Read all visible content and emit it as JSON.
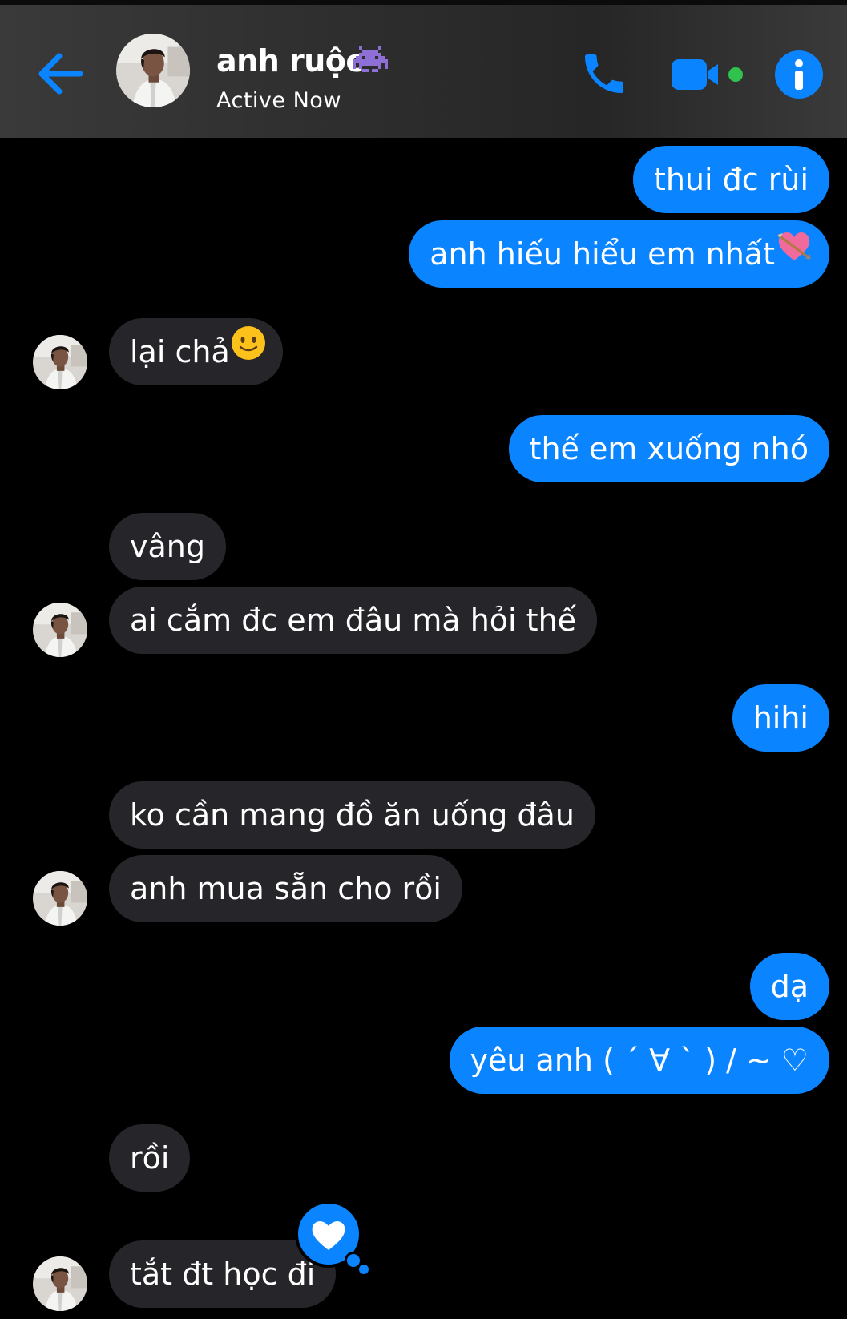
{
  "header": {
    "contact_name": "anh ruộc",
    "status": "Active Now",
    "name_emoji_icon": "alien-monster-icon",
    "accent_color": "#0a84ff"
  },
  "messages": [
    {
      "side": "out",
      "text": "thui đc rùi"
    },
    {
      "side": "out",
      "text": "anh hiếu hiểu em nhất",
      "emoji_icon": "heart-with-arrow-icon"
    },
    {
      "side": "in",
      "text": "lại chả",
      "emoji_icon": "slightly-smiling-face-icon"
    },
    {
      "side": "out",
      "text": "thế em xuống nhó"
    },
    {
      "side": "in",
      "text": "vâng"
    },
    {
      "side": "in",
      "text": "ai cắm đc em đâu mà hỏi thế"
    },
    {
      "side": "out",
      "text": "hihi"
    },
    {
      "side": "in",
      "text": "ko cần mang đồ ăn uống đâu"
    },
    {
      "side": "in",
      "text": "anh mua sẵn cho rồi"
    },
    {
      "side": "out",
      "text": "dạ"
    },
    {
      "side": "out",
      "text": "yêu anh ( ´ ∀ ` ) / ~ ♡"
    },
    {
      "side": "in",
      "text": "rồi"
    },
    {
      "side": "in",
      "text": "tắt đt học đi",
      "reaction_icon": "heart-reaction-icon"
    }
  ],
  "colors": {
    "outgoing_bubble": "#0a84ff",
    "incoming_bubble": "#262529",
    "background": "#000000"
  }
}
